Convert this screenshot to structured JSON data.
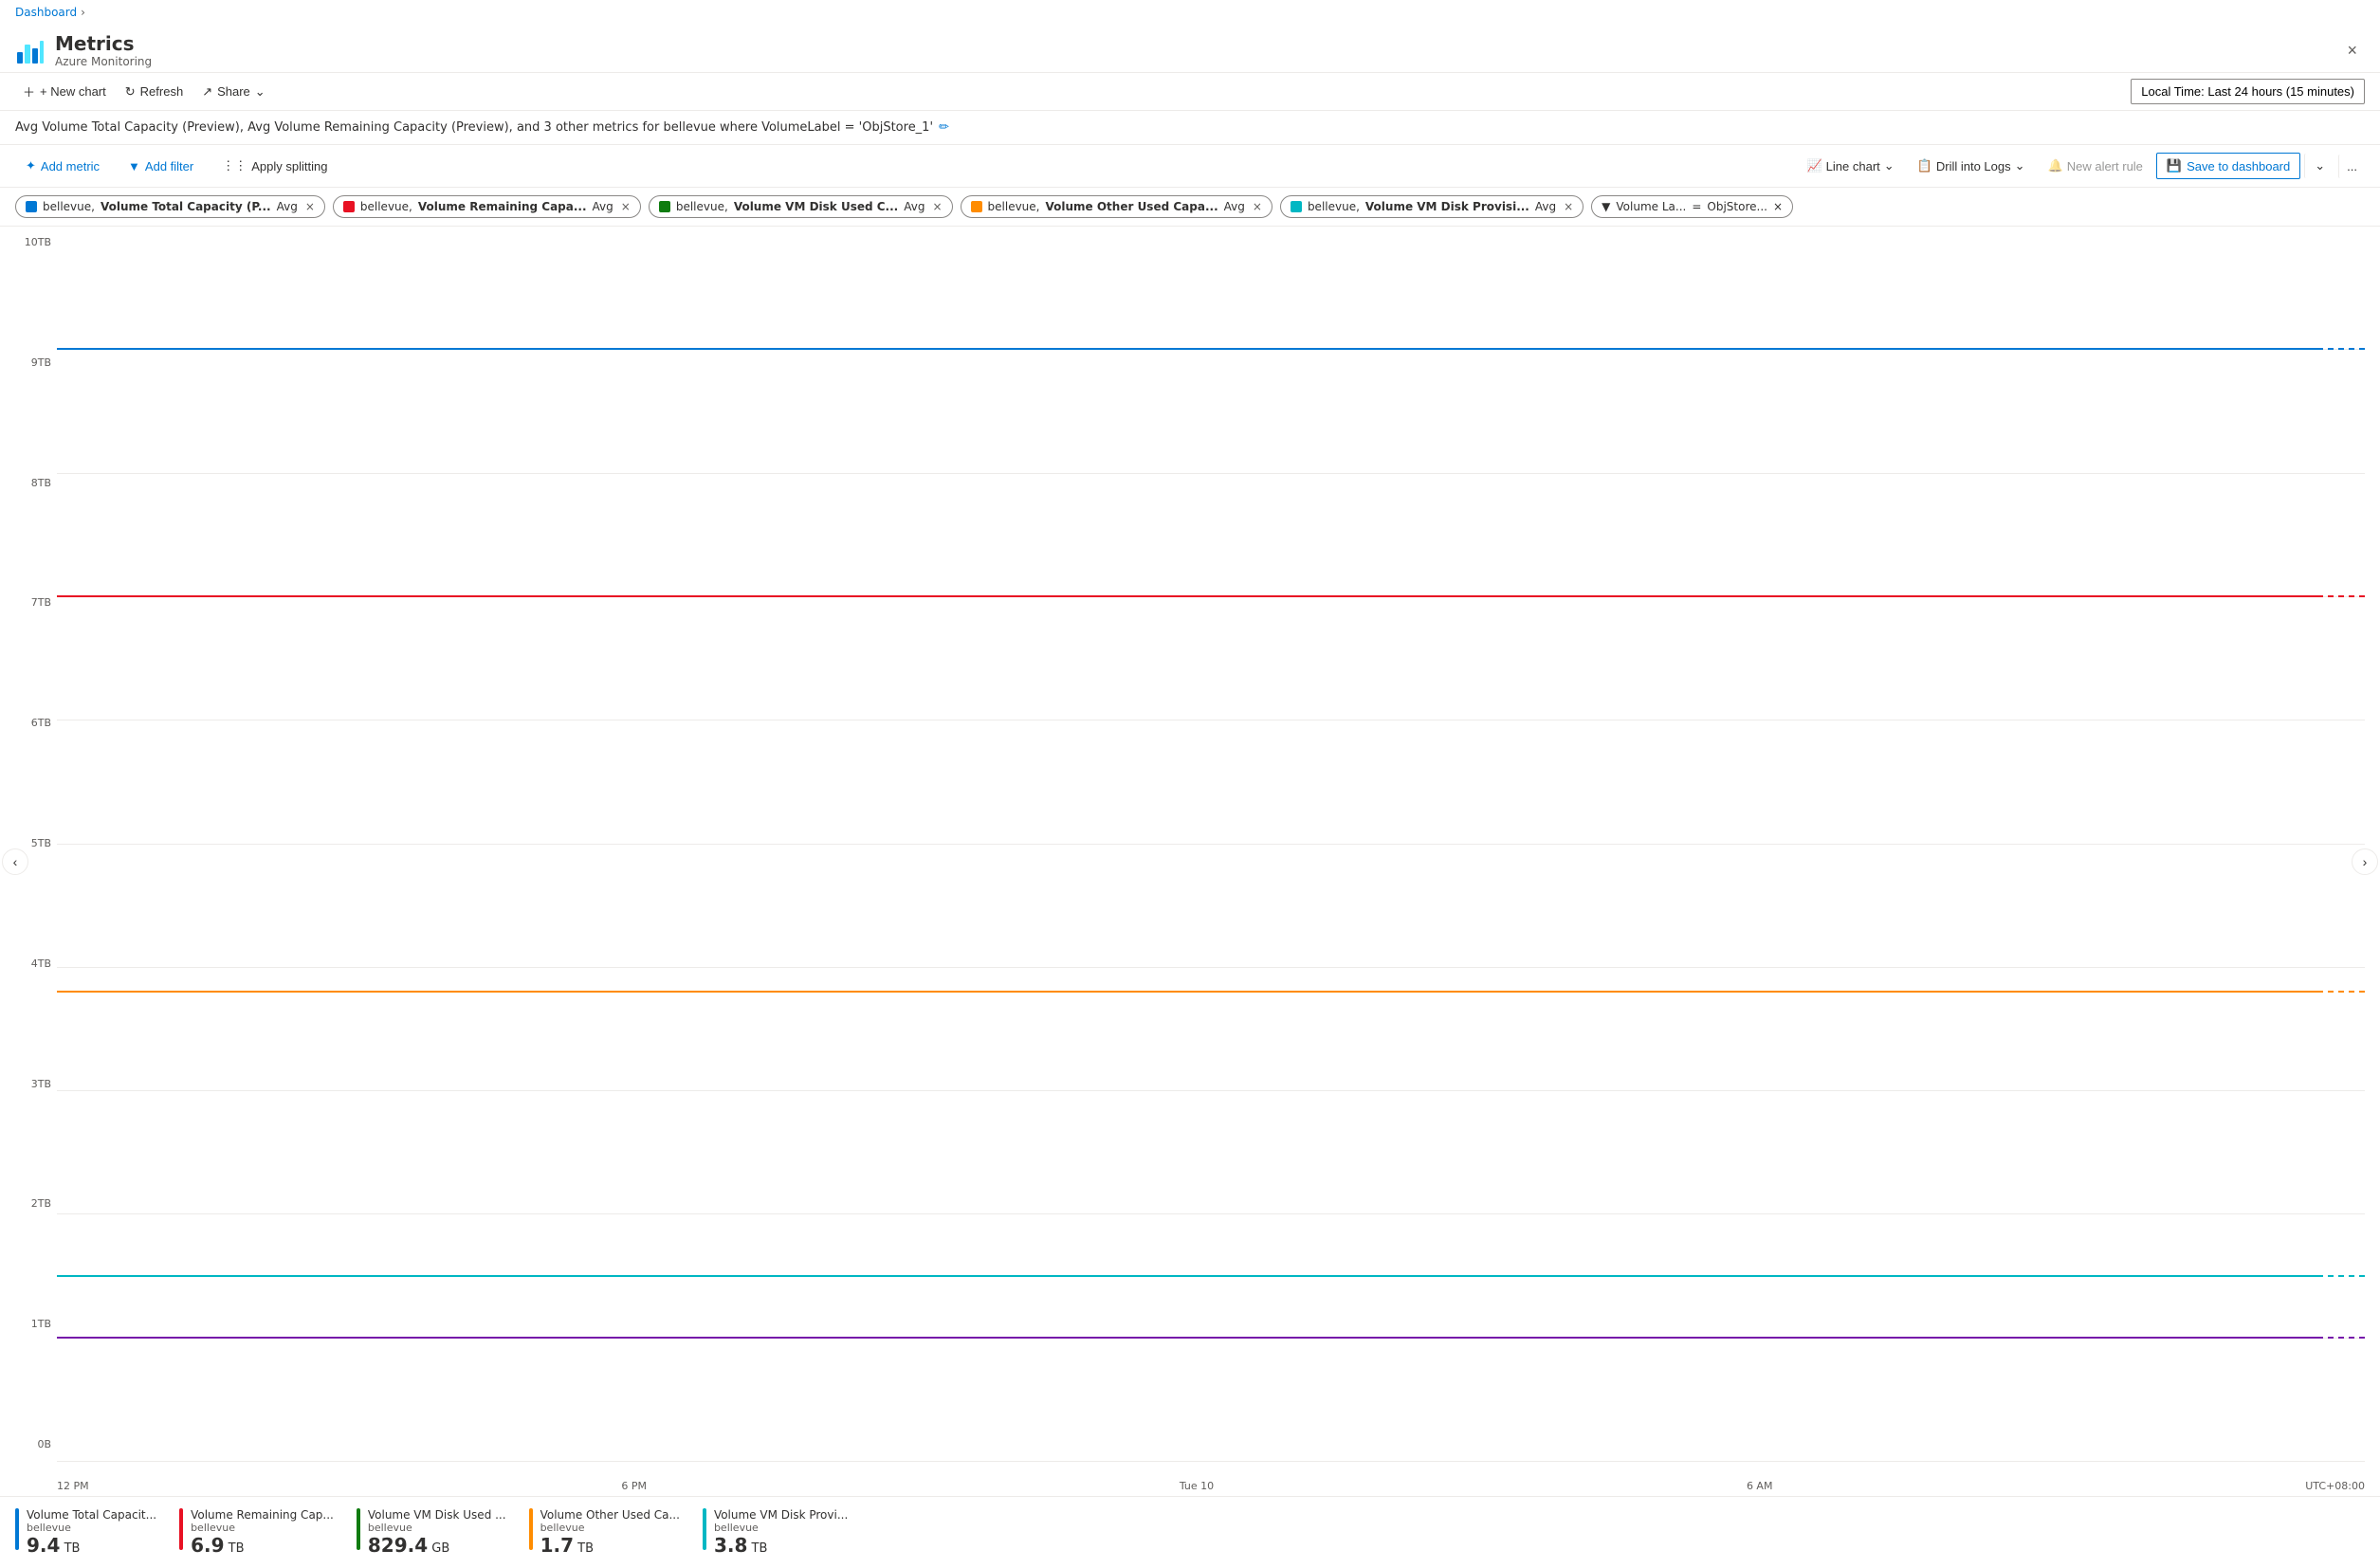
{
  "breadcrumb": {
    "items": [
      "Dashboard"
    ],
    "chevron": "›"
  },
  "header": {
    "title": "Metrics",
    "subtitle": "Azure Monitoring",
    "close_label": "×"
  },
  "top_toolbar": {
    "new_chart": "+ New chart",
    "refresh": "Refresh",
    "share": "Share",
    "time_range": "Local Time: Last 24 hours (15 minutes)"
  },
  "chart_title": "Avg Volume Total Capacity (Preview), Avg Volume Remaining Capacity (Preview), and 3 other metrics for bellevue where VolumeLabel = 'ObjStore_1'",
  "metrics_toolbar": {
    "add_metric": "Add metric",
    "add_filter": "Add filter",
    "apply_splitting": "Apply splitting",
    "line_chart": "Line chart",
    "drill_into_logs": "Drill into Logs",
    "new_alert_rule": "New alert rule",
    "save_to_dashboard": "Save to dashboard",
    "more": "..."
  },
  "filter_tags": [
    {
      "id": "tag1",
      "color": "#0078d4",
      "prefix": "bellevue,",
      "bold": "Volume Total Capacity (P...",
      "suffix": "Avg"
    },
    {
      "id": "tag2",
      "color": "#e81123",
      "prefix": "bellevue,",
      "bold": "Volume Remaining Capa...",
      "suffix": "Avg"
    },
    {
      "id": "tag3",
      "color": "#107c10",
      "prefix": "bellevue,",
      "bold": "Volume VM Disk Used C...",
      "suffix": "Avg"
    },
    {
      "id": "tag4",
      "color": "#ff8c00",
      "prefix": "bellevue,",
      "bold": "Volume Other Used Capa...",
      "suffix": "Avg"
    },
    {
      "id": "tag5",
      "color": "#00b7c3",
      "prefix": "bellevue,",
      "bold": "Volume VM Disk Provisi...",
      "suffix": "Avg"
    }
  ],
  "volume_filter": {
    "label": "Volume La...",
    "operator": "=",
    "value": "ObjStore..."
  },
  "y_axis_labels": [
    "0B",
    "1TB",
    "2TB",
    "3TB",
    "4TB",
    "5TB",
    "6TB",
    "7TB",
    "8TB",
    "9TB",
    "10TB"
  ],
  "x_axis_labels": [
    "12 PM",
    "6 PM",
    "Tue 10",
    "6 AM",
    "UTC+08:00"
  ],
  "chart_lines": [
    {
      "id": "line1",
      "color": "#0078d4",
      "top_pct": 8,
      "label": "9TB line"
    },
    {
      "id": "line2",
      "color": "#e81123",
      "top_pct": 30,
      "label": "7TB line"
    },
    {
      "id": "line3",
      "color": "#ff8c00",
      "top_pct": 60,
      "label": "4TB line"
    },
    {
      "id": "line4",
      "color": "#00b7c3",
      "top_pct": 77,
      "label": "1.5TB line"
    },
    {
      "id": "line5",
      "color": "#7719aa",
      "top_pct": 82,
      "label": "1TB line"
    }
  ],
  "legend_items": [
    {
      "id": "leg1",
      "color": "#0078d4",
      "title": "Volume Total Capacit...",
      "sub": "bellevue",
      "value": "9.4",
      "unit": "TB"
    },
    {
      "id": "leg2",
      "color": "#e81123",
      "title": "Volume Remaining Cap...",
      "sub": "bellevue",
      "value": "6.9",
      "unit": "TB"
    },
    {
      "id": "leg3",
      "color": "#107c10",
      "title": "Volume VM Disk Used ...",
      "sub": "bellevue",
      "value": "829.4",
      "unit": "GB"
    },
    {
      "id": "leg4",
      "color": "#ff8c00",
      "title": "Volume Other Used Ca...",
      "sub": "bellevue",
      "value": "1.7",
      "unit": "TB"
    },
    {
      "id": "leg5",
      "color": "#00b7c3",
      "title": "Volume VM Disk Provi...",
      "sub": "bellevue",
      "value": "3.8",
      "unit": "TB"
    }
  ],
  "nav": {
    "left": "‹",
    "right": "›"
  }
}
